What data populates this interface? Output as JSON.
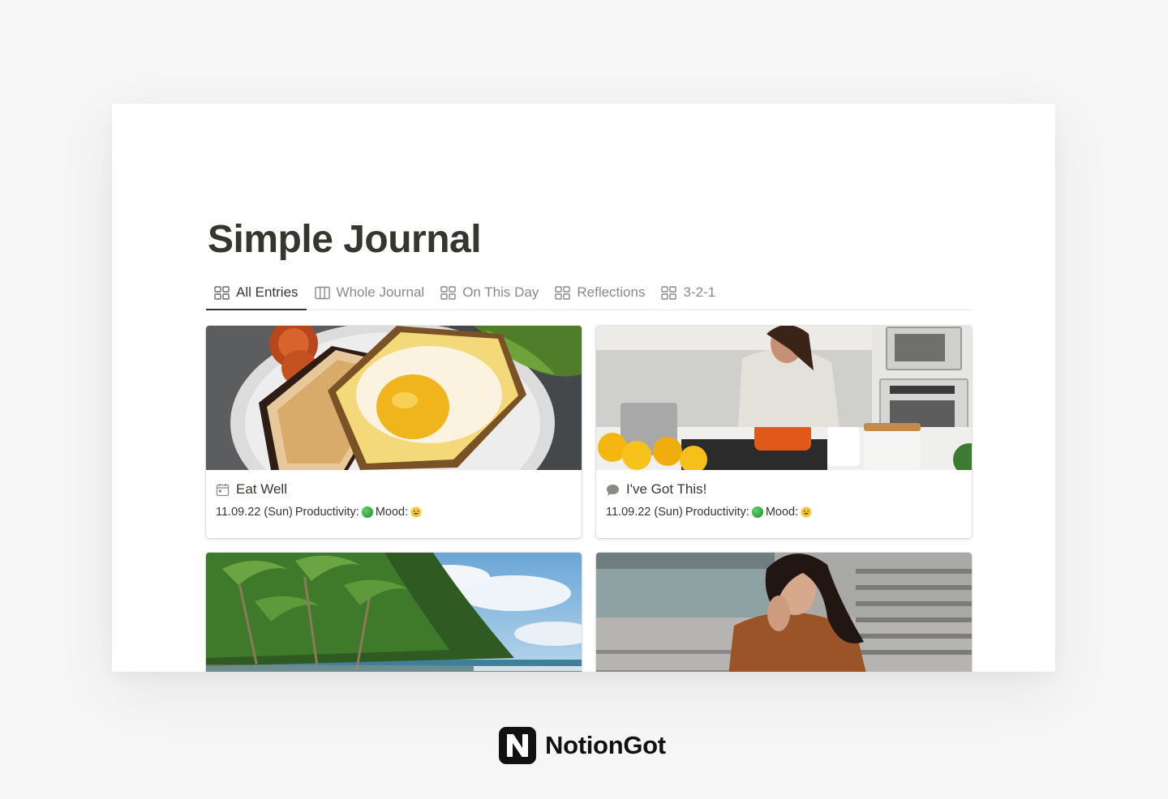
{
  "page": {
    "title": "Simple Journal"
  },
  "tabs": [
    {
      "label": "All Entries",
      "icon": "gallery-icon",
      "active": true
    },
    {
      "label": "Whole Journal",
      "icon": "board-icon",
      "active": false
    },
    {
      "label": "On This Day",
      "icon": "gallery-icon",
      "active": false
    },
    {
      "label": "Reflections",
      "icon": "gallery-icon",
      "active": false
    },
    {
      "label": "3-2-1",
      "icon": "gallery-icon",
      "active": false
    }
  ],
  "cards": [
    {
      "title": "Eat Well",
      "icon": "calendar-icon",
      "cover": "breakfast-egg-toast-photo",
      "date": "11.09.22 (Sun)",
      "productivity_label": "Productivity:",
      "productivity_status": "green",
      "mood_label": "Mood:",
      "mood": "smiley-face"
    },
    {
      "title": "I've Got This!",
      "icon": "speech-bubble-icon",
      "cover": "woman-cooking-kitchen-photo",
      "date": "11.09.22 (Sun)",
      "productivity_label": "Productivity:",
      "productivity_status": "green",
      "mood_label": "Mood:",
      "mood": "smiley-face"
    },
    {
      "title": "",
      "cover": "tropical-beach-palms-photo"
    },
    {
      "title": "",
      "cover": "woman-thinking-stairs-photo"
    }
  ],
  "brand": {
    "name": "NotionGot",
    "logo_letter": "N"
  },
  "colors": {
    "text": "#37352f",
    "muted": "#8a8984",
    "status_green": "#2ea043",
    "mood_yellow": "#f2c94c"
  }
}
